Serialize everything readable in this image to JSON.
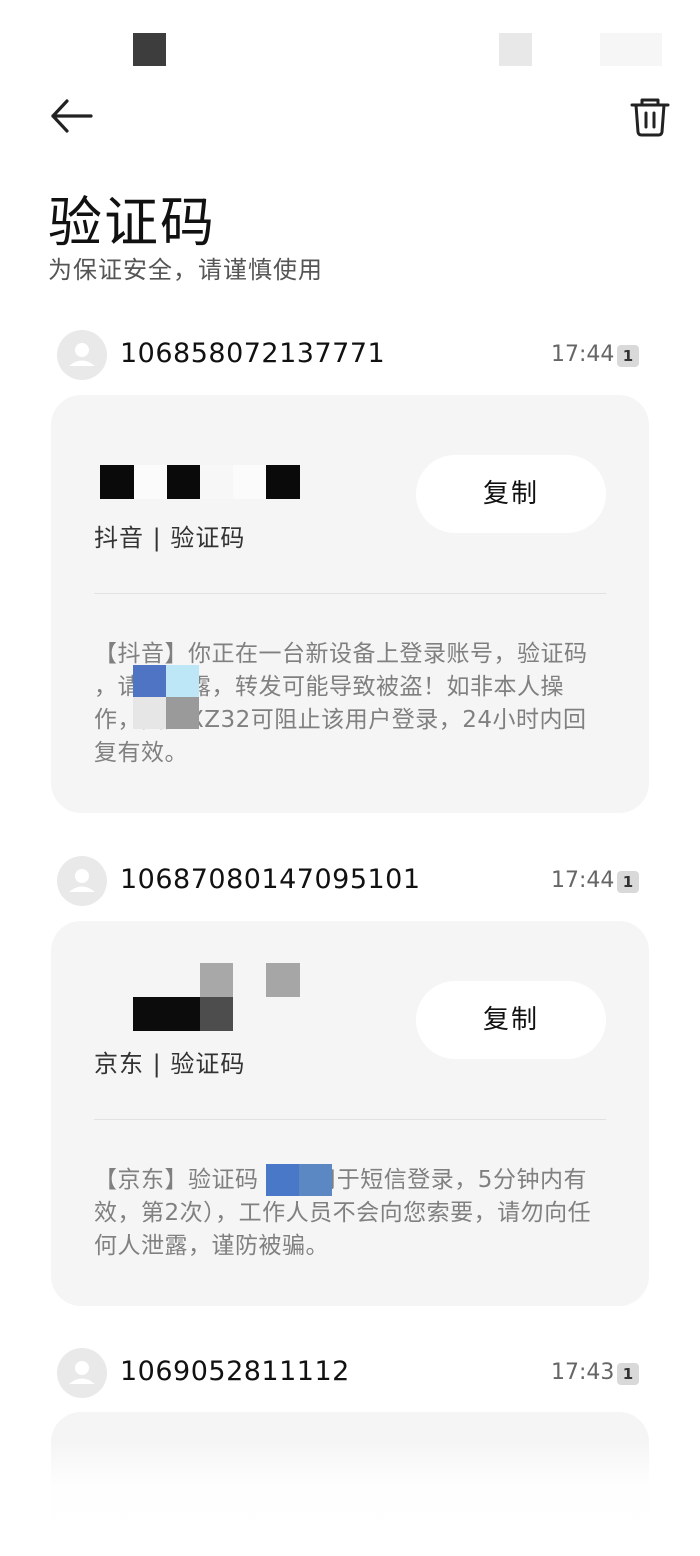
{
  "header": {
    "title": "验证码",
    "subtitle": "为保证安全，请谨慎使用"
  },
  "icons": {
    "back": "arrow-left-icon",
    "delete": "trash-icon",
    "avatar": "person-icon"
  },
  "messages": [
    {
      "sender": "106858072137771",
      "time": "17:44",
      "sim": "1",
      "code_label": "抖音 | 验证码",
      "copy_label": "复制",
      "body": "【抖音】你正在一台新设备上登录账号，验证码        ，请勿泄露，转发可能导致被盗！如非本人操作，回复XZ32可阻止该用户登录，24小时内回复有效。"
    },
    {
      "sender": "10687080147095101",
      "time": "17:44",
      "sim": "1",
      "code_label": "京东 | 验证码",
      "copy_label": "复制",
      "body": "【京东】验证码          （仅用于短信登录，5分钟内有效，第2次），工作人员不会向您索要，请勿向任何人泄露，谨防被骗。"
    },
    {
      "sender": "1069052811112",
      "time": "17:43",
      "sim": "1"
    }
  ],
  "colors": {
    "background": "#ffffff",
    "card": "#f5f5f5",
    "copy_button": "#ffffff",
    "redact_blue": "#5b7fc9"
  }
}
